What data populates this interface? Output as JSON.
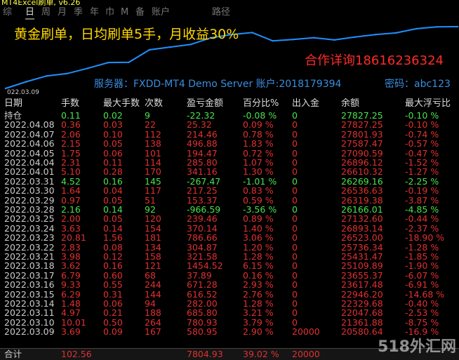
{
  "window": {
    "title": "MT4Excel刷单, v6.26"
  },
  "tabs": [
    {
      "label": "综",
      "active": false
    },
    {
      "label": "日",
      "active": true
    },
    {
      "label": "周",
      "active": false
    },
    {
      "label": "月",
      "active": false
    },
    {
      "label": "季",
      "active": false
    },
    {
      "label": "年",
      "active": false
    },
    {
      "label": "巾",
      "active": false
    },
    {
      "label": "M",
      "active": false
    },
    {
      "label": "备",
      "active": false
    },
    {
      "label": "账户",
      "active": false
    },
    {
      "label": "路径",
      "active": false
    }
  ],
  "promo": {
    "headline": "黄金刷单，日均刷单5手，月收益30%",
    "contact": "合作详询18616236324",
    "server_info": "服务器：FXDD-MT4 Demo Server 账户:2018179394",
    "password": "密码：abc123"
  },
  "chart_data": {
    "type": "line",
    "x_start_label": "022.03.09",
    "x": [
      "03.09",
      "03.10",
      "03.11",
      "03.14",
      "03.15",
      "03.16",
      "03.17",
      "03.18",
      "03.21",
      "03.22",
      "03.23",
      "03.24",
      "03.25",
      "03.28",
      "03.29",
      "03.30",
      "03.31",
      "04.01",
      "04.04",
      "04.05",
      "04.06",
      "04.07",
      "04.08"
    ],
    "values": [
      20580.64,
      21361.88,
      22047.68,
      22329.68,
      22946.2,
      23617.48,
      23655.37,
      25109.89,
      25431.47,
      25736.34,
      26523.0,
      26893.14,
      27132.6,
      26166.01,
      26319.38,
      26536.63,
      26269.16,
      26610.32,
      26896.12,
      27090.59,
      27587.47,
      27801.93,
      27827.25
    ],
    "line_color": "#1e90ff"
  },
  "columns": [
    "日期",
    "手数",
    "最大手数",
    "次数",
    "盈亏金额",
    "百分比%",
    "出入金",
    "余额",
    "最大浮亏比"
  ],
  "holding_row": {
    "date": "持仓",
    "lots": "0.11",
    "max_lots": "0.02",
    "count": "9",
    "pnl": "-22.32",
    "pct": "-0.08 %",
    "flow": "0",
    "balance": "27827.25",
    "max_dd": "-0.10 %"
  },
  "rows": [
    {
      "date": "2022.04.08",
      "lots": "0.36",
      "max_lots": "0.03",
      "count": "22",
      "pnl": "25.32",
      "pct": "0.09 %",
      "flow": "0",
      "balance": "27827.25",
      "max_dd": "-0.10 %",
      "color": "#e23030"
    },
    {
      "date": "2022.04.07",
      "lots": "2.06",
      "max_lots": "0.10",
      "count": "112",
      "pnl": "214.46",
      "pct": "0.78 %",
      "flow": "0",
      "balance": "27801.93",
      "max_dd": "-0.74 %",
      "color": "#e23030"
    },
    {
      "date": "2022.04.06",
      "lots": "2.15",
      "max_lots": "0.05",
      "count": "138",
      "pnl": "496.88",
      "pct": "1.83 %",
      "flow": "0",
      "balance": "27587.47",
      "max_dd": "-0.57 %",
      "color": "#e23030"
    },
    {
      "date": "2022.04.05",
      "lots": "1.75",
      "max_lots": "0.06",
      "count": "101",
      "pnl": "194.47",
      "pct": "0.72 %",
      "flow": "0",
      "balance": "27090.59",
      "max_dd": "-0.47 %",
      "color": "#e23030"
    },
    {
      "date": "2022.04.04",
      "lots": "2.31",
      "max_lots": "0.11",
      "count": "114",
      "pnl": "285.80",
      "pct": "1.07 %",
      "flow": "0",
      "balance": "26896.12",
      "max_dd": "-1.52 %",
      "color": "#e23030"
    },
    {
      "date": "2022.04.01",
      "lots": "5.10",
      "max_lots": "0.28",
      "count": "170",
      "pnl": "341.16",
      "pct": "1.30 %",
      "flow": "0",
      "balance": "26610.32",
      "max_dd": "-1.27 %",
      "color": "#e23030"
    },
    {
      "date": "2022.03.31",
      "lots": "4.52",
      "max_lots": "0.16",
      "count": "145",
      "pnl": "-267.47",
      "pct": "-1.01 %",
      "flow": "0",
      "balance": "26269.16",
      "max_dd": "-2.25 %",
      "color": "#4be24b"
    },
    {
      "date": "2022.03.30",
      "lots": "1.64",
      "max_lots": "0.04",
      "count": "117",
      "pnl": "217.25",
      "pct": "0.83 %",
      "flow": "0",
      "balance": "26536.63",
      "max_dd": "-0.19 %",
      "color": "#e23030"
    },
    {
      "date": "2022.03.29",
      "lots": "0.97",
      "max_lots": "0.05",
      "count": "51",
      "pnl": "153.37",
      "pct": "0.59 %",
      "flow": "0",
      "balance": "26319.38",
      "max_dd": "-3.87 %",
      "color": "#e23030"
    },
    {
      "date": "2022.03.28",
      "lots": "2.16",
      "max_lots": "0.14",
      "count": "92",
      "pnl": "-966.59",
      "pct": "-3.56 %",
      "flow": "0",
      "balance": "26166.01",
      "max_dd": "-4.85 %",
      "color": "#4be24b"
    },
    {
      "date": "2022.03.25",
      "lots": "2.00",
      "max_lots": "0.05",
      "count": "120",
      "pnl": "239.46",
      "pct": "0.89 %",
      "flow": "0",
      "balance": "27132.60",
      "max_dd": "-0.44 %",
      "color": "#e23030"
    },
    {
      "date": "2022.03.24",
      "lots": "3.63",
      "max_lots": "0.14",
      "count": "154",
      "pnl": "370.14",
      "pct": "1.40 %",
      "flow": "0",
      "balance": "26893.14",
      "max_dd": "-2.37 %",
      "color": "#e23030"
    },
    {
      "date": "2022.03.23",
      "lots": "20.81",
      "max_lots": "1.56",
      "count": "181",
      "pnl": "786.66",
      "pct": "3.06 %",
      "flow": "0",
      "balance": "26523.00",
      "max_dd": "-18.90 %",
      "color": "#e23030"
    },
    {
      "date": "2022.03.22",
      "lots": "2.83",
      "max_lots": "0.08",
      "count": "134",
      "pnl": "304.87",
      "pct": "1.20 %",
      "flow": "0",
      "balance": "25736.34",
      "max_dd": "-1.28 %",
      "color": "#e23030"
    },
    {
      "date": "2022.03.21",
      "lots": "3.98",
      "max_lots": "0.12",
      "count": "158",
      "pnl": "321.58",
      "pct": "1.28 %",
      "flow": "0",
      "balance": "25431.47",
      "max_dd": "-1.85 %",
      "color": "#e23030"
    },
    {
      "date": "2022.03.18",
      "lots": "3.62",
      "max_lots": "0.16",
      "count": "121",
      "pnl": "1454.52",
      "pct": "6.15 %",
      "flow": "0",
      "balance": "25109.89",
      "max_dd": "-1.90 %",
      "color": "#e23030"
    },
    {
      "date": "2022.03.17",
      "lots": "6.79",
      "max_lots": "0.60",
      "count": "68",
      "pnl": "37.89",
      "pct": "0.16 %",
      "flow": "0",
      "balance": "23655.37",
      "max_dd": "-6.07 %",
      "color": "#e23030"
    },
    {
      "date": "2022.03.16",
      "lots": "9.33",
      "max_lots": "0.55",
      "count": "244",
      "pnl": "671.28",
      "pct": "2.93 %",
      "flow": "0",
      "balance": "23617.48",
      "max_dd": "-6.91 %",
      "color": "#e23030"
    },
    {
      "date": "2022.03.15",
      "lots": "6.29",
      "max_lots": "0.31",
      "count": "144",
      "pnl": "616.52",
      "pct": "2.76 %",
      "flow": "0",
      "balance": "22946.20",
      "max_dd": "-14.68 %",
      "color": "#e23030"
    },
    {
      "date": "2022.03.14",
      "lots": "1.48",
      "max_lots": "0.06",
      "count": "94",
      "pnl": "282.00",
      "pct": "1.28 %",
      "flow": "0",
      "balance": "22329.68",
      "max_dd": "-0.40 %",
      "color": "#e23030"
    },
    {
      "date": "2022.03.11",
      "lots": "4.97",
      "max_lots": "0.21",
      "count": "188",
      "pnl": "685.80",
      "pct": "3.21 %",
      "flow": "0",
      "balance": "22047.68",
      "max_dd": "-2.53 %",
      "color": "#e23030"
    },
    {
      "date": "2022.03.10",
      "lots": "10.01",
      "max_lots": "0.50",
      "count": "264",
      "pnl": "780.93",
      "pct": "3.79 %",
      "flow": "0",
      "balance": "21361.88",
      "max_dd": "-8.75 %",
      "color": "#e23030"
    },
    {
      "date": "2022.03.09",
      "lots": "3.69",
      "max_lots": "0.09",
      "count": "167",
      "pnl": "580.95",
      "pct": "2.90 %",
      "flow": "20000",
      "balance": "20580.64",
      "max_dd": "-16.9 %",
      "color": "#e23030"
    }
  ],
  "footer": {
    "label": "合计",
    "lots": "102.56",
    "pnl": "7804.93",
    "pct": "39.02 %",
    "flow": "20000"
  },
  "watermark": "518外汇网",
  "colors": {
    "up": "#e23030",
    "down": "#4be24b",
    "header": "#dddddd",
    "promo_yellow": "#ffd700",
    "promo_red": "#ff2a2a",
    "promo_blue": "#3a8dde",
    "chart_line": "#1e90ff"
  }
}
